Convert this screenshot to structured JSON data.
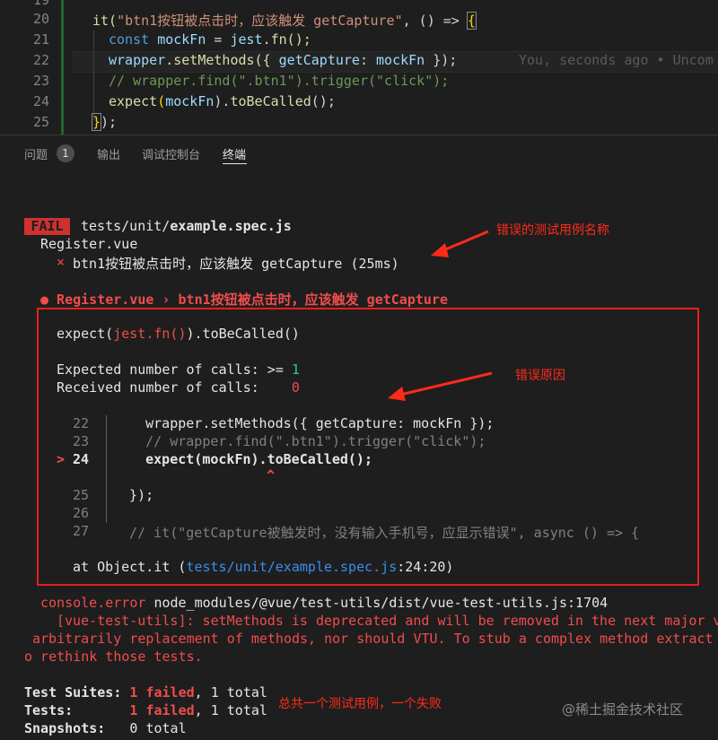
{
  "editor": {
    "line_numbers": [
      "19",
      "20",
      "21",
      "22",
      "23",
      "24",
      "25"
    ],
    "line20": {
      "a": "it(",
      "b": "\"btn1按钮被点击时，应该触发 getCapture\"",
      "c": ", () => ",
      "d": "{"
    },
    "line21": {
      "a": "const ",
      "b": "mockFn",
      "c": " = ",
      "d": "jest",
      ".e": "",
      "e": ".fn();"
    },
    "line22": {
      "a": "wrapper",
      "b": ".setMethods({ ",
      "c": "getCapture",
      "d": ": ",
      "e": "mockFn",
      "f": " });"
    },
    "blame": "You, seconds ago • Uncom",
    "line23": "// wrapper.find(\".btn1\").trigger(\"click\");",
    "line24": {
      "a": "expect",
      "b": "(",
      "c": "mockFn",
      "d": ").",
      "e": "toBeCalled",
      "f": "();"
    },
    "line25": {
      "a": "}",
      "b": ");"
    }
  },
  "tabs": {
    "problems": "问题",
    "problems_count": "1",
    "output": "输出",
    "debug_console": "调试控制台",
    "terminal": "终端"
  },
  "terminal": {
    "fail_label": "FAIL",
    "test_path_prefix": "tests/unit/",
    "test_file": "example.spec.js",
    "suite_name": "Register.vue",
    "failed_mark": "×",
    "failed_test": "btn1按钮被点击时，应该触发 getCapture (25ms)",
    "error_title": "● Register.vue › btn1按钮被点击时，应该触发 getCapture",
    "expect_a": "expect(",
    "expect_b": "jest.fn()",
    "expect_c": ").toBeCalled()",
    "expected_label": "Expected number of calls: >= ",
    "expected_value": "1",
    "received_label": "Received number of calls:    ",
    "received_value": "0",
    "snippet": [
      {
        "num": "22",
        "text": "    wrapper.setMethods({ getCapture: mockFn });"
      },
      {
        "num": "23",
        "text": "    // wrapper.find(\".btn1\").trigger(\"click\");"
      },
      {
        "num": "24",
        "text": "    expect(mockFn).toBeCalled();"
      },
      {
        "num": "25",
        "text": "  });"
      },
      {
        "num": "26",
        "text": ""
      },
      {
        "num": "27",
        "text": "  // it(\"getCapture被触发时，没有输入手机号，应显示错误\", async () => {"
      }
    ],
    "current_marker": ">",
    "caret": "^",
    "at_prefix": "at Object.it (",
    "at_link": "tests/unit/example.spec.js",
    "at_suffix": ":24:20)",
    "console_error_label": "console.error ",
    "console_error_path": "node_modules/@vue/test-utils/dist/vue-test-utils.js:1704",
    "warn_line1": "[vue-test-utils]: setMethods is deprecated and will be removed in the next major v",
    "warn_line2": "arbitrarily replacement of methods, nor should VTU. To stub a complex method extract",
    "warn_line3": "o rethink those tests.",
    "suites_label": "Test Suites: ",
    "tests_label": "Tests:       ",
    "snapshots_label": "Snapshots:   ",
    "failed_text": "1 failed",
    "total_text": ", 1 total",
    "snapshots_value": "0 total"
  },
  "annotations": {
    "wrong_test_name": "错误的测试用例名称",
    "error_reason": "错误原因",
    "summary_note": "总共一个测试用例，一个失败"
  },
  "watermark": "@稀土掘金技术社区",
  "colors": {
    "fail_red": "#cd3131",
    "annotation_red": "#ff2a1a",
    "link_blue": "#3b8eea",
    "bg": "#1e1e1e"
  }
}
